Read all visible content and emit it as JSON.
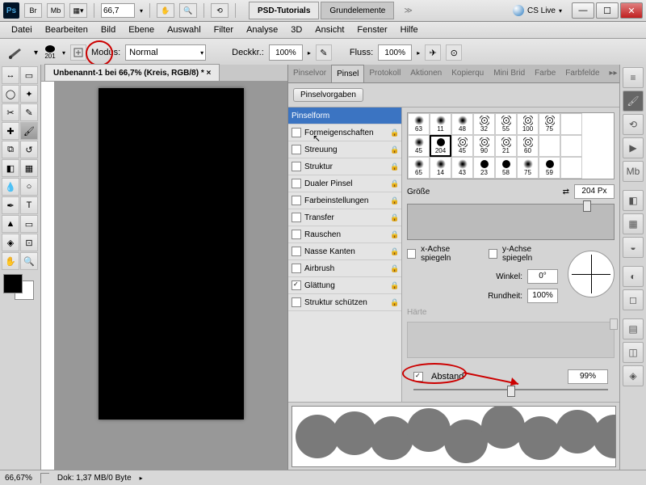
{
  "title": {
    "psd_tutorials": "PSD-Tutorials",
    "grundelemente": "Grundelemente",
    "cslive": "CS Live"
  },
  "zoom_title": "66,7",
  "menu": [
    "Datei",
    "Bearbeiten",
    "Bild",
    "Ebene",
    "Auswahl",
    "Filter",
    "Analyse",
    "3D",
    "Ansicht",
    "Fenster",
    "Hilfe"
  ],
  "options": {
    "brush_size": "201",
    "modus_label": "Modus:",
    "modus_value": "Normal",
    "deckkr_label": "Deckkr.:",
    "deckkr_value": "100%",
    "fluss_label": "Fluss:",
    "fluss_value": "100%"
  },
  "doc_tab": "Unbenannt-1 bei 66,7% (Kreis, RGB/8) *",
  "panel": {
    "tabs": [
      "Pinselvor",
      "Pinsel",
      "Protokoll",
      "Aktionen",
      "Kopierqu",
      "Mini Brid",
      "Farbe",
      "Farbfelde"
    ],
    "active_tab": "Pinsel",
    "preset_btn": "Pinselvorgaben",
    "shape_header": "Pinselform",
    "shape_items": [
      {
        "label": "Formeigenschaften",
        "checked": false,
        "lock": true
      },
      {
        "label": "Streuung",
        "checked": false,
        "lock": true
      },
      {
        "label": "Struktur",
        "checked": false,
        "lock": true
      },
      {
        "label": "Dualer Pinsel",
        "checked": false,
        "lock": true
      },
      {
        "label": "Farbeinstellungen",
        "checked": false,
        "lock": true
      },
      {
        "label": "Transfer",
        "checked": false,
        "lock": true
      },
      {
        "label": "Rauschen",
        "checked": false,
        "lock": true
      },
      {
        "label": "Nasse Kanten",
        "checked": false,
        "lock": true
      },
      {
        "label": "Airbrush",
        "checked": false,
        "lock": true
      },
      {
        "label": "Glättung",
        "checked": true,
        "lock": true
      },
      {
        "label": "Struktur schützen",
        "checked": false,
        "lock": true
      }
    ],
    "brush_grid": [
      [
        {
          "n": "63",
          "t": "soft"
        },
        {
          "n": "11",
          "t": "soft"
        },
        {
          "n": "48",
          "t": "soft"
        },
        {
          "n": "32",
          "t": "tex"
        },
        {
          "n": "55",
          "t": "tex"
        },
        {
          "n": "100",
          "t": "tex"
        },
        {
          "n": "75",
          "t": "tex"
        },
        {
          "n": "",
          "t": ""
        }
      ],
      [
        {
          "n": "45",
          "t": "soft"
        },
        {
          "n": "204",
          "t": "c",
          "sel": true
        },
        {
          "n": "45",
          "t": "tex"
        },
        {
          "n": "90",
          "t": "tex"
        },
        {
          "n": "21",
          "t": "tex"
        },
        {
          "n": "60",
          "t": "tex"
        },
        {
          "n": "",
          "t": ""
        },
        {
          "n": "",
          "t": ""
        }
      ],
      [
        {
          "n": "65",
          "t": "soft"
        },
        {
          "n": "14",
          "t": "soft"
        },
        {
          "n": "43",
          "t": "soft"
        },
        {
          "n": "23",
          "t": "c"
        },
        {
          "n": "58",
          "t": "c"
        },
        {
          "n": "75",
          "t": "soft"
        },
        {
          "n": "59",
          "t": "c"
        },
        {
          "n": "",
          "t": ""
        }
      ]
    ],
    "size_label": "Größe",
    "size_value": "204 Px",
    "mirror_x": "x-Achse spiegeln",
    "mirror_y": "y-Achse spiegeln",
    "angle_label": "Winkel:",
    "angle_value": "0°",
    "round_label": "Rundheit:",
    "round_value": "100%",
    "hardness_label": "Härte",
    "spacing_label": "Abstand",
    "spacing_value": "99%"
  },
  "status": {
    "zoom": "66,67%",
    "dok": "Dok: 1,37 MB/0 Byte"
  }
}
